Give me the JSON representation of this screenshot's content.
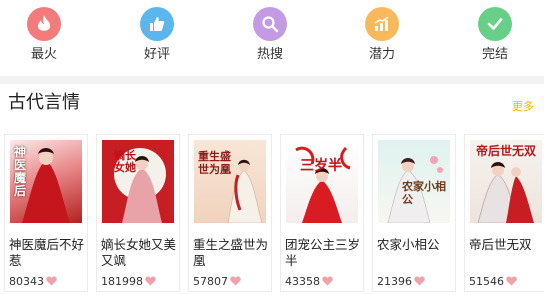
{
  "nav": [
    {
      "label": "最火",
      "icon": "flame-icon",
      "color": "#f47b7b"
    },
    {
      "label": "好评",
      "icon": "thumbs-up-icon",
      "color": "#5bb6ee"
    },
    {
      "label": "热搜",
      "icon": "search-icon",
      "color": "#c39be2"
    },
    {
      "label": "潜力",
      "icon": "bar-chart-icon",
      "color": "#f8b95a"
    },
    {
      "label": "完结",
      "icon": "check-icon",
      "color": "#68cf89"
    }
  ],
  "section": {
    "title": "古代言情",
    "more_label": "更多"
  },
  "books": [
    {
      "title": "神医魔后不好惹",
      "count": "80343",
      "cover_text": "神医魔后"
    },
    {
      "title": "嫡长女她又美又飒",
      "count": "181998",
      "cover_text": "嫡长女她"
    },
    {
      "title": "重生之盛世为凰",
      "count": "57807",
      "cover_text": "重生盛世为凰"
    },
    {
      "title": "团宠公主三岁半",
      "count": "43358",
      "cover_text": "三岁半"
    },
    {
      "title": "农家小相公",
      "count": "21396",
      "cover_text": "农家小相公"
    },
    {
      "title": "帝后世无双",
      "count": "51546",
      "cover_text": "帝后世无双"
    }
  ],
  "colors": {
    "accent": "#f5b400",
    "heart": "#f4a0a8"
  }
}
